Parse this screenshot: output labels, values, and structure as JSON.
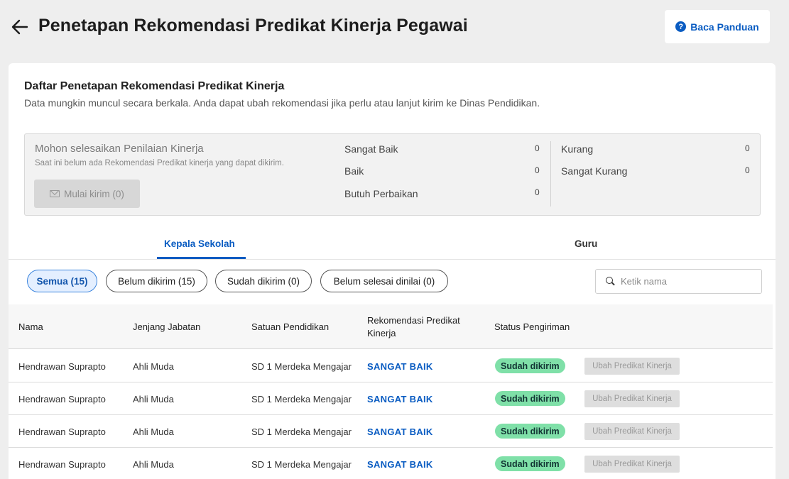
{
  "header": {
    "title": "Penetapan Rekomendasi Predikat Kinerja Pegawai",
    "guide_label": "Baca Panduan",
    "help_icon_glyph": "?"
  },
  "card": {
    "title": "Daftar Penetapan Rekomendasi Predikat Kinerja",
    "subtitle": "Data mungkin muncul secara berkala. Anda dapat ubah rekomendasi jika perlu atau lanjut kirim ke Dinas Pendidikan."
  },
  "summary": {
    "title": "Mohon selesaikan Penilaian Kinerja",
    "description": "Saat ini belum ada Rekomendasi Predikat kinerja yang dapat dikirim.",
    "send_label": "Mulai kirim (0)",
    "stats": [
      {
        "label": "Sangat Baik",
        "value": "0"
      },
      {
        "label": "Baik",
        "value": "0"
      },
      {
        "label": "Butuh Perbaikan",
        "value": "0"
      },
      {
        "label": "Kurang",
        "value": "0"
      },
      {
        "label": "Sangat Kurang",
        "value": "0"
      }
    ]
  },
  "tabs": [
    {
      "label": "Kepala Sekolah",
      "active": true
    },
    {
      "label": "Guru",
      "active": false
    }
  ],
  "filters": [
    {
      "label": "Semua (15)",
      "active": true
    },
    {
      "label": "Belum dikirim (15)",
      "active": false
    },
    {
      "label": "Sudah dikirim (0)",
      "active": false
    },
    {
      "label": "Belum selesai dinilai (0)",
      "active": false
    }
  ],
  "search": {
    "placeholder": "Ketik nama",
    "value": ""
  },
  "table": {
    "headers": [
      "Nama",
      "Jenjang Jabatan",
      "Satuan Pendidikan",
      "Rekomendasi Predikat Kinerja",
      "Status Pengiriman"
    ],
    "rows": [
      {
        "nama": "Hendrawan Suprapto",
        "jabatan": "Ahli Muda",
        "satuan": "SD 1 Merdeka Mengajar",
        "predikat": "SANGAT BAIK",
        "status": "Sudah dikirim",
        "action": "Ubah Predikat Kinerja"
      },
      {
        "nama": "Hendrawan Suprapto",
        "jabatan": "Ahli Muda",
        "satuan": "SD 1 Merdeka Mengajar",
        "predikat": "SANGAT BAIK",
        "status": "Sudah dikirim",
        "action": "Ubah Predikat Kinerja"
      },
      {
        "nama": "Hendrawan Suprapto",
        "jabatan": "Ahli Muda",
        "satuan": "SD 1 Merdeka Mengajar",
        "predikat": "SANGAT BAIK",
        "status": "Sudah dikirim",
        "action": "Ubah Predikat Kinerja"
      },
      {
        "nama": "Hendrawan Suprapto",
        "jabatan": "Ahli Muda",
        "satuan": "SD 1 Merdeka Mengajar",
        "predikat": "SANGAT BAIK",
        "status": "Sudah dikirim",
        "action": "Ubah Predikat Kinerja"
      }
    ]
  },
  "colors": {
    "accent": "#0a5cc2",
    "badge_green": "#7fe0a8",
    "page_bg": "#eeeeee"
  }
}
